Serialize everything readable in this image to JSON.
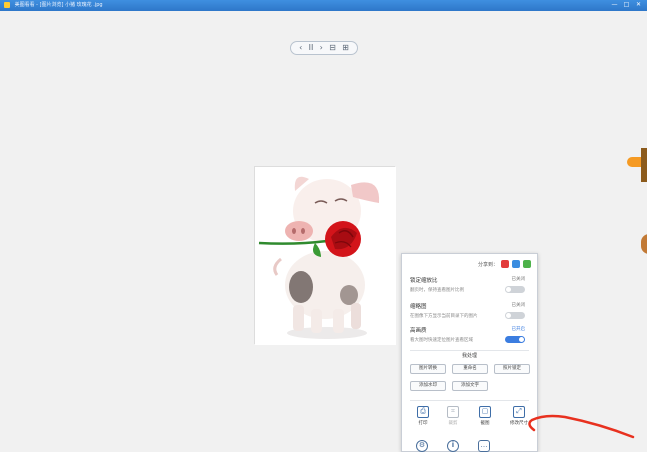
{
  "window": {
    "title": "美图看看 - [图片浏览] 小猪 玫瑰花 .jpg",
    "controls": [
      "—",
      "□",
      "✕"
    ]
  },
  "nav": {
    "prev": "‹",
    "play": "II",
    "next": "›",
    "view1": "⊟",
    "view2": "⊞"
  },
  "menu": {
    "share_label": "分享到：",
    "options": [
      {
        "title": "锁定缩放比",
        "state": "已关闭",
        "desc": "翻页时，保持查看图片比例",
        "on": false
      },
      {
        "title": "缩略图",
        "state": "已关闭",
        "desc": "在图像下方显示当前目录下的图片",
        "on": false
      },
      {
        "title": "高画质",
        "state": "已开启",
        "desc": "看大图时快速定位图片查看区域",
        "on": true
      }
    ],
    "section": "我处理",
    "buttons": [
      "图片转换",
      "重命名",
      "照片锁定",
      "添加水印",
      "添加文字"
    ],
    "tools": [
      {
        "label": "打印",
        "icon": "printer-icon",
        "glyph": "⎙",
        "disabled": false
      },
      {
        "label": "裁剪",
        "icon": "crop-icon",
        "glyph": "⌗",
        "disabled": true
      },
      {
        "label": "截图",
        "icon": "screenshot-icon",
        "glyph": "▢",
        "disabled": false
      },
      {
        "label": "修改尺寸",
        "icon": "resize-icon",
        "glyph": "⤢",
        "disabled": false
      }
    ],
    "bottom_icons": [
      {
        "icon": "settings-icon",
        "glyph": "⚙"
      },
      {
        "icon": "info-icon",
        "glyph": "i"
      },
      {
        "icon": "feedback-icon",
        "glyph": "…"
      }
    ]
  },
  "colors": {
    "titlebar": "#3580d5",
    "accent": "#3b7de0",
    "annotation": "#e8311f"
  }
}
